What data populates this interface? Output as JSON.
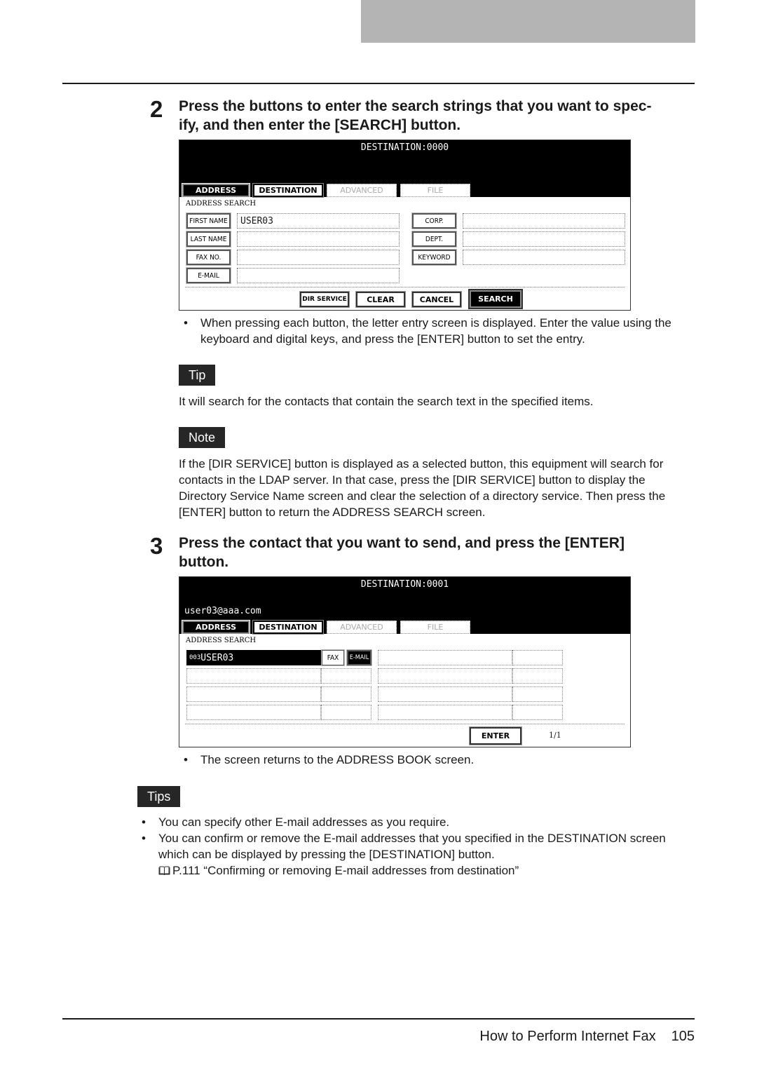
{
  "page": {
    "footer_title": "How to Perform Internet Fax",
    "page_number": "105"
  },
  "step2": {
    "number": "2",
    "heading": "Press the buttons to enter the search strings that you want to specify, and then enter the [SEARCH] button.",
    "heading_line1": "Press the buttons to enter the search strings that you want to spec-",
    "heading_line2": "ify, and then enter the [SEARCH] button.",
    "screen": {
      "title": "DESTINATION:0000",
      "tabs": [
        {
          "label": "ADDRESS",
          "state": "active"
        },
        {
          "label": "DESTINATION",
          "state": "normal"
        },
        {
          "label": "ADVANCED",
          "state": "disabled"
        },
        {
          "label": "FILE",
          "state": "disabled"
        }
      ],
      "section_label": "ADDRESS SEARCH",
      "left_fields": [
        {
          "label": "FIRST NAME",
          "value": "USER03"
        },
        {
          "label": "LAST NAME",
          "value": ""
        },
        {
          "label": "FAX NO.",
          "value": ""
        },
        {
          "label": "E-MAIL",
          "value": ""
        }
      ],
      "right_fields": [
        {
          "label": "CORP.",
          "value": ""
        },
        {
          "label": "DEPT.",
          "value": ""
        },
        {
          "label": "KEYWORD",
          "value": ""
        }
      ],
      "buttons": {
        "dir_service": "DIR SERVICE",
        "clear": "CLEAR",
        "cancel": "CANCEL",
        "search": "SEARCH"
      }
    },
    "bullets": [
      "When pressing each button, the letter entry screen is displayed.  Enter the value using the keyboard and digital keys, and press the [ENTER] button to set the entry."
    ],
    "tip_label": "Tip",
    "tip_text": "It will search for the contacts that contain the search text in the specified items.",
    "note_label": "Note",
    "note_text": "If the [DIR SERVICE] button is displayed as a selected button, this equipment will search for contacts in the LDAP server.  In that case, press the [DIR SERVICE] button to display the Directory Service Name screen and clear the selection of a directory service.  Then press the [ENTER] button to return the ADDRESS SEARCH screen."
  },
  "step3": {
    "number": "3",
    "heading_line1": "Press the contact that you want to send, and press the [ENTER]",
    "heading_line2": "button.",
    "screen": {
      "title": "DESTINATION:0001",
      "selected_address": "user03@aaa.com",
      "tabs": [
        {
          "label": "ADDRESS",
          "state": "active"
        },
        {
          "label": "DESTINATION",
          "state": "normal"
        },
        {
          "label": "ADVANCED",
          "state": "disabled"
        },
        {
          "label": "FILE",
          "state": "disabled"
        }
      ],
      "section_label": "ADDRESS SEARCH",
      "results": [
        {
          "index": "003",
          "name": "USER03",
          "fax_label": "FAX",
          "email_label": "E-MAIL",
          "selected": true
        }
      ],
      "enter_label": "ENTER",
      "page_indicator": "1/1"
    },
    "bullets": [
      "The screen returns to the ADDRESS BOOK screen."
    ]
  },
  "tips": {
    "label": "Tips",
    "bullets": [
      "You can specify other E-mail addresses as you require.",
      "You can confirm or remove the E-mail addresses that you specified in the DESTINATION screen which can be displayed by pressing the [DESTINATION] button."
    ],
    "reference_icon": "book-icon",
    "reference": "P.111 “Confirming or removing E-mail addresses from destination”"
  }
}
